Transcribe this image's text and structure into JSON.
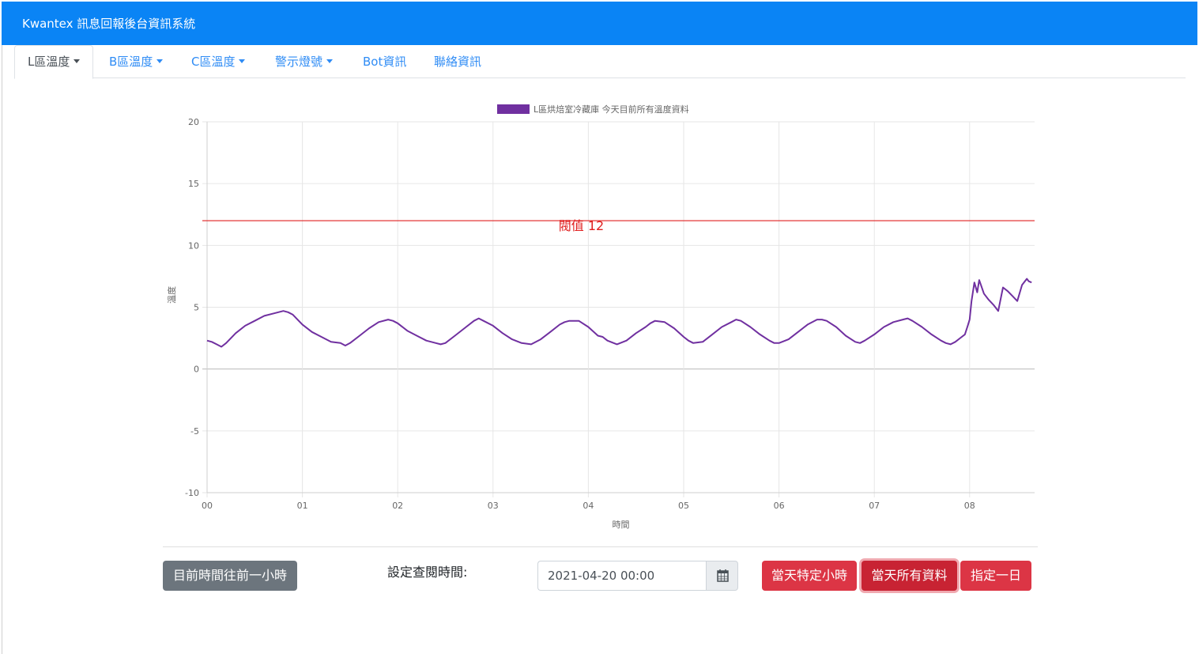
{
  "app": {
    "title": "Kwantex 訊息回報後台資訊系統"
  },
  "tabs": [
    {
      "label": "L區溫度",
      "dropdown": true,
      "active": true
    },
    {
      "label": "B區溫度",
      "dropdown": true,
      "active": false
    },
    {
      "label": "C區溫度",
      "dropdown": true,
      "active": false
    },
    {
      "label": "警示燈號",
      "dropdown": true,
      "active": false
    },
    {
      "label": "Bot資訊",
      "dropdown": false,
      "active": false
    },
    {
      "label": "聯絡資訊",
      "dropdown": false,
      "active": false
    }
  ],
  "controls": {
    "prev_hour_label": "目前時間往前一小時",
    "set_time_label": "設定查閱時間:",
    "date_value": "2021-04-20 00:00",
    "specific_hour_label": "當天特定小時",
    "all_day_label": "當天所有資料",
    "pick_day_label": "指定一日",
    "calendar_icon": "calendar-icon"
  },
  "colors": {
    "navbar": "#0a84f5",
    "series": "#7030a0",
    "threshold": "#e02020",
    "btn_gray": "#6c757d",
    "btn_red": "#dc3545"
  },
  "chart_data": {
    "type": "line",
    "legend": "L區烘焙室冷藏庫 今天目前所有溫度資料",
    "legend_position": "top",
    "xlabel": "時間",
    "ylabel": "溫度",
    "xticks": [
      "00",
      "01",
      "02",
      "03",
      "04",
      "05",
      "06",
      "07",
      "08"
    ],
    "ylim": [
      -10,
      20
    ],
    "yticks": [
      -10,
      -5,
      0,
      5,
      10,
      15,
      20
    ],
    "grid": true,
    "threshold": {
      "value": 12,
      "label": "閥值 12"
    },
    "series": [
      {
        "name": "L區烘焙室冷藏庫 今天目前所有溫度資料",
        "x_hours": [
          0.0,
          0.05,
          0.1,
          0.15,
          0.2,
          0.3,
          0.4,
          0.5,
          0.6,
          0.7,
          0.8,
          0.85,
          0.9,
          1.0,
          1.1,
          1.2,
          1.3,
          1.4,
          1.45,
          1.5,
          1.6,
          1.7,
          1.8,
          1.9,
          1.95,
          2.0,
          2.1,
          2.2,
          2.3,
          2.4,
          2.45,
          2.5,
          2.6,
          2.7,
          2.8,
          2.85,
          2.9,
          3.0,
          3.1,
          3.2,
          3.3,
          3.4,
          3.5,
          3.6,
          3.7,
          3.75,
          3.8,
          3.9,
          4.0,
          4.1,
          4.15,
          4.2,
          4.3,
          4.4,
          4.5,
          4.6,
          4.65,
          4.7,
          4.8,
          4.9,
          5.0,
          5.05,
          5.1,
          5.2,
          5.3,
          5.4,
          5.5,
          5.55,
          5.6,
          5.7,
          5.8,
          5.9,
          5.95,
          6.0,
          6.1,
          6.2,
          6.3,
          6.4,
          6.45,
          6.5,
          6.6,
          6.7,
          6.8,
          6.85,
          6.9,
          7.0,
          7.1,
          7.2,
          7.3,
          7.35,
          7.4,
          7.5,
          7.6,
          7.7,
          7.75,
          7.8,
          7.85,
          7.9,
          7.95,
          7.98,
          8.0,
          8.02,
          8.05,
          8.08,
          8.1,
          8.15,
          8.2,
          8.25,
          8.3,
          8.35,
          8.4,
          8.45,
          8.5,
          8.55,
          8.6,
          8.62,
          8.65
        ],
        "values": [
          2.3,
          2.2,
          2.0,
          1.8,
          2.1,
          2.9,
          3.5,
          3.9,
          4.3,
          4.5,
          4.7,
          4.6,
          4.4,
          3.6,
          3.0,
          2.6,
          2.2,
          2.1,
          1.9,
          2.1,
          2.7,
          3.3,
          3.8,
          4.0,
          3.9,
          3.7,
          3.1,
          2.7,
          2.3,
          2.1,
          2.0,
          2.1,
          2.7,
          3.3,
          3.9,
          4.1,
          3.9,
          3.5,
          2.9,
          2.4,
          2.1,
          2.0,
          2.4,
          3.0,
          3.6,
          3.8,
          3.9,
          3.9,
          3.4,
          2.7,
          2.6,
          2.3,
          2.0,
          2.3,
          2.9,
          3.4,
          3.7,
          3.9,
          3.8,
          3.3,
          2.6,
          2.3,
          2.1,
          2.2,
          2.8,
          3.4,
          3.8,
          4.0,
          3.9,
          3.4,
          2.8,
          2.3,
          2.1,
          2.1,
          2.4,
          3.0,
          3.6,
          4.0,
          4.0,
          3.9,
          3.4,
          2.7,
          2.2,
          2.1,
          2.3,
          2.8,
          3.4,
          3.8,
          4.0,
          4.1,
          3.9,
          3.4,
          2.8,
          2.3,
          2.1,
          2.0,
          2.2,
          2.5,
          2.8,
          3.5,
          4.0,
          5.5,
          7.0,
          6.2,
          7.2,
          6.1,
          5.6,
          5.2,
          4.7,
          6.6,
          6.3,
          5.9,
          5.5,
          6.8,
          7.3,
          7.1,
          7.0
        ]
      }
    ]
  }
}
